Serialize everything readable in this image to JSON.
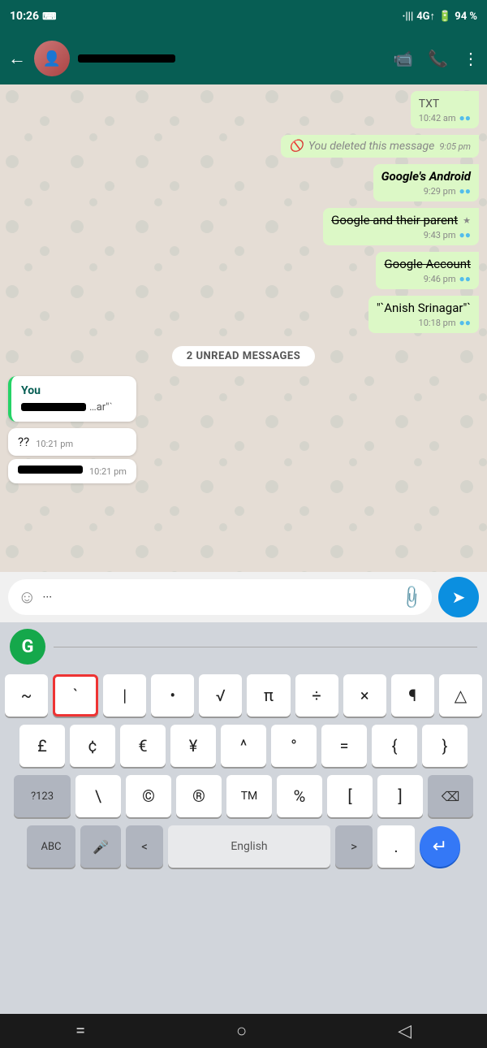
{
  "statusBar": {
    "time": "10:26",
    "signal": "4G↑",
    "battery": "94 %"
  },
  "header": {
    "nameBar": "",
    "videoCallIcon": "📹",
    "callIcon": "📞",
    "menuIcon": "⋮"
  },
  "messages": [
    {
      "id": 1,
      "type": "out",
      "text": "TXT",
      "time": "10:42 am",
      "ticks": "●●",
      "special": "plain"
    },
    {
      "id": 2,
      "type": "out",
      "text": "You deleted this message",
      "time": "9:05 pm",
      "deleted": true
    },
    {
      "id": 3,
      "type": "out",
      "text": "Google's Android",
      "time": "9:29 pm",
      "ticks": "●●",
      "italic": true
    },
    {
      "id": 4,
      "type": "out",
      "text": "Google and their parent",
      "time": "9:43 pm",
      "ticks": "●●",
      "strike": true,
      "starIcon": true
    },
    {
      "id": 5,
      "type": "out",
      "text": "Google Account",
      "time": "9:46 pm",
      "ticks": "●●",
      "strike": true
    },
    {
      "id": 6,
      "type": "out",
      "text": "\"`Anish Srinagar\"`",
      "time": "10:18 pm",
      "ticks": "●●"
    }
  ],
  "unreadDivider": "2 UNREAD MESSAGES",
  "replyBubble": {
    "label": "You",
    "previewText": "…ar\"ˋ"
  },
  "inlineMessages": [
    {
      "text": "??",
      "time": "10:21 pm"
    },
    {
      "blackBar": true,
      "time": "10:21 pm"
    }
  ],
  "inputArea": {
    "emojiIcon": "☺",
    "inputDots": "···",
    "attachIcon": "📎",
    "sendIcon": "➤"
  },
  "keyboard": {
    "grammarlyLabel": "G",
    "row1": [
      "~",
      "`",
      "|",
      "•",
      "√",
      "π",
      "÷",
      "×",
      "¶",
      "△"
    ],
    "row2": [
      "£",
      "¢",
      "€",
      "¥",
      "^",
      "°",
      "=",
      "{",
      "}"
    ],
    "row3Left": "?123",
    "row3Mid": [
      "\\",
      "©",
      "®",
      "™",
      "%",
      "[",
      "]"
    ],
    "row3Right": "⌫",
    "row4Left": "ABC",
    "row4Mic": "🎤",
    "row4Arrows": [
      "<",
      ">"
    ],
    "row4Space": "English",
    "row4Dot": ".",
    "row4Enter": "↵"
  },
  "bottomNav": {
    "home": "=",
    "circle": "○",
    "back": "◁"
  }
}
